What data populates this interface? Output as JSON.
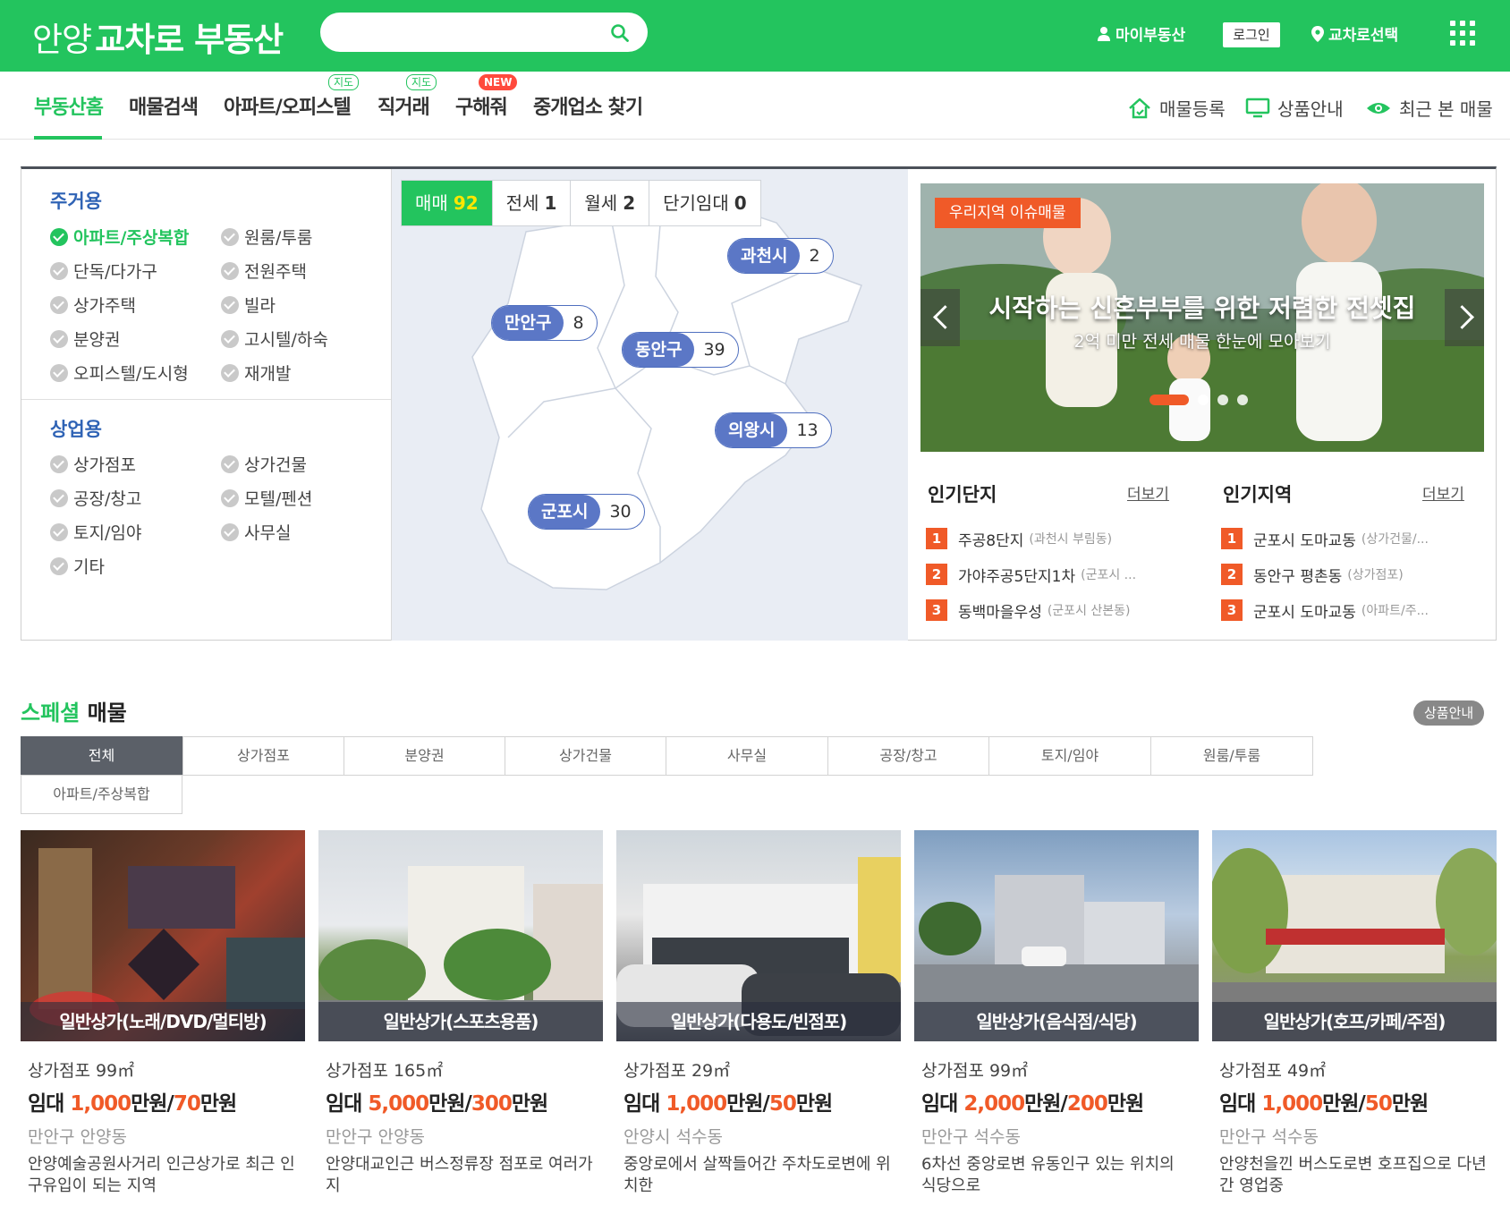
{
  "header": {
    "logo_light": "안양",
    "logo_bold": "교차로 부동산",
    "search_placeholder": "",
    "my_estate": "마이부동산",
    "login": "로그인",
    "region_select": "교차로선택"
  },
  "nav": {
    "items": [
      {
        "label": "부동산홈"
      },
      {
        "label": "매물검색"
      },
      {
        "label": "아파트/오피스텔",
        "badge": "지도"
      },
      {
        "label": "직거래",
        "badge": "지도"
      },
      {
        "label": "구해줘",
        "badge": "NEW"
      },
      {
        "label": "중개업소 찾기"
      }
    ],
    "right": [
      {
        "label": "매물등록",
        "icon": "house-icon"
      },
      {
        "label": "상품안내",
        "icon": "monitor-icon"
      },
      {
        "label": "최근 본 매물",
        "icon": "eye-icon"
      }
    ]
  },
  "categories": {
    "residential": {
      "title": "주거용",
      "items": [
        "아파트/주상복합",
        "원룸/투룸",
        "단독/다가구",
        "전원주택",
        "상가주택",
        "빌라",
        "분양권",
        "고시텔/하숙",
        "오피스텔/도시형",
        "재개발"
      ],
      "selected": "아파트/주상복합"
    },
    "commercial": {
      "title": "상업용",
      "items": [
        "상가점포",
        "상가건물",
        "공장/창고",
        "모텔/펜션",
        "토지/임야",
        "사무실",
        "기타"
      ]
    }
  },
  "map": {
    "deal_tabs": [
      {
        "label": "매매",
        "count": "92"
      },
      {
        "label": "전세",
        "count": "1"
      },
      {
        "label": "월세",
        "count": "2"
      },
      {
        "label": "단기임대",
        "count": "0"
      }
    ],
    "regions": [
      {
        "name": "과천시",
        "count": "2"
      },
      {
        "name": "만안구",
        "count": "8"
      },
      {
        "name": "동안구",
        "count": "39"
      },
      {
        "name": "의왕시",
        "count": "13"
      },
      {
        "name": "군포시",
        "count": "30"
      }
    ]
  },
  "banner": {
    "tag": "우리지역 이슈매물",
    "title": "시작하는 신혼부부를 위한 저렴한 전셋집",
    "subtitle": "2억 미만 전세 매물 한눈에 모아보기"
  },
  "popular_complex": {
    "title": "인기단지",
    "more": "더보기",
    "items": [
      {
        "rank": "1",
        "name": "주공8단지",
        "loc": "(과천시 부림동)"
      },
      {
        "rank": "2",
        "name": "가야주공5단지1차",
        "loc": "(군포시 ..."
      },
      {
        "rank": "3",
        "name": "동백마을우성",
        "loc": "(군포시 산본동)"
      }
    ]
  },
  "popular_region": {
    "title": "인기지역",
    "more": "더보기",
    "items": [
      {
        "rank": "1",
        "name": "군포시 도마교동",
        "loc": "(상가건물/..."
      },
      {
        "rank": "2",
        "name": "동안구 평촌동",
        "loc": "(상가점포)"
      },
      {
        "rank": "3",
        "name": "군포시 도마교동",
        "loc": "(아파트/주..."
      }
    ]
  },
  "special": {
    "title_accent": "스페셜",
    "title_rest": " 매물",
    "info_button": "상품안내",
    "tabs": [
      "전체",
      "상가점포",
      "분양권",
      "상가건물",
      "사무실",
      "공장/창고",
      "토지/임야",
      "원룸/투룸",
      "아파트/주상복합"
    ],
    "cards": [
      {
        "caption": "일반상가(노래/DVD/멀티방)",
        "type": "상가점포 99㎡",
        "deal": "임대 ",
        "deposit": "1,000",
        "u1": "만원/",
        "rent": "70",
        "u2": "만원",
        "loc": "만안구 안양동",
        "desc": "안양예술공원사거리 인근상가로 최근 인구유입이 되는 지역"
      },
      {
        "caption": "일반상가(스포츠용품)",
        "type": "상가점포 165㎡",
        "deal": "임대 ",
        "deposit": "5,000",
        "u1": "만원/",
        "rent": "300",
        "u2": "만원",
        "loc": "만안구 안양동",
        "desc": "안양대교인근 버스정류장 점포로 여러가지"
      },
      {
        "caption": "일반상가(다용도/빈점포)",
        "type": "상가점포 29㎡",
        "deal": "임대 ",
        "deposit": "1,000",
        "u1": "만원/",
        "rent": "50",
        "u2": "만원",
        "loc": "안양시 석수동",
        "desc": "중앙로에서 살짝들어간 주차도로변에 위치한"
      },
      {
        "caption": "일반상가(음식점/식당)",
        "type": "상가점포 99㎡",
        "deal": "임대 ",
        "deposit": "2,000",
        "u1": "만원/",
        "rent": "200",
        "u2": "만원",
        "loc": "만안구 석수동",
        "desc": "6차선 중앙로변 유동인구 있는 위치의 식당으로"
      },
      {
        "caption": "일반상가(호프/카페/주점)",
        "type": "상가점포 49㎡",
        "deal": "임대 ",
        "deposit": "1,000",
        "u1": "만원/",
        "rent": "50",
        "u2": "만원",
        "loc": "만안구 석수동",
        "desc": "안양천을낀 버스도로변 호프집으로 다년간 영업중"
      }
    ]
  },
  "colors": {
    "brand_green": "#23c45e",
    "accent_orange": "#f05a28",
    "region_blue": "#5b77c6"
  }
}
